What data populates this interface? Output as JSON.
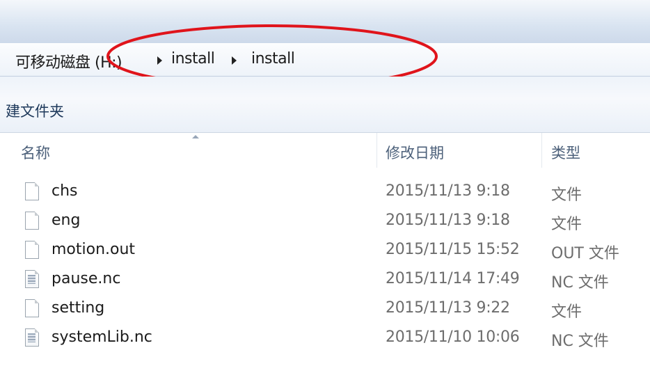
{
  "breadcrumb": {
    "root": "可移动磁盘 (H:)",
    "items": [
      "install",
      "install"
    ]
  },
  "toolbar": {
    "new_folder_label": "建文件夹"
  },
  "columns": {
    "name": "名称",
    "date": "修改日期",
    "type": "类型"
  },
  "files": [
    {
      "name": "chs",
      "date": "2015/11/13 9:18",
      "type": "文件",
      "icon": "blank-file-icon"
    },
    {
      "name": "eng",
      "date": "2015/11/13 9:18",
      "type": "文件",
      "icon": "blank-file-icon"
    },
    {
      "name": "motion.out",
      "date": "2015/11/15 15:52",
      "type": "OUT 文件",
      "icon": "blank-file-icon"
    },
    {
      "name": "pause.nc",
      "date": "2015/11/14 17:49",
      "type": "NC 文件",
      "icon": "text-file-icon"
    },
    {
      "name": "setting",
      "date": "2015/11/13 9:22",
      "type": "文件",
      "icon": "blank-file-icon"
    },
    {
      "name": "systemLib.nc",
      "date": "2015/11/10 10:06",
      "type": "NC 文件",
      "icon": "text-file-icon"
    }
  ],
  "colors": {
    "highlight_ellipse": "#e0141b",
    "toolbar_text": "#1e395b",
    "header_text": "#4c607a",
    "secondary_text": "#6d6d6d"
  }
}
